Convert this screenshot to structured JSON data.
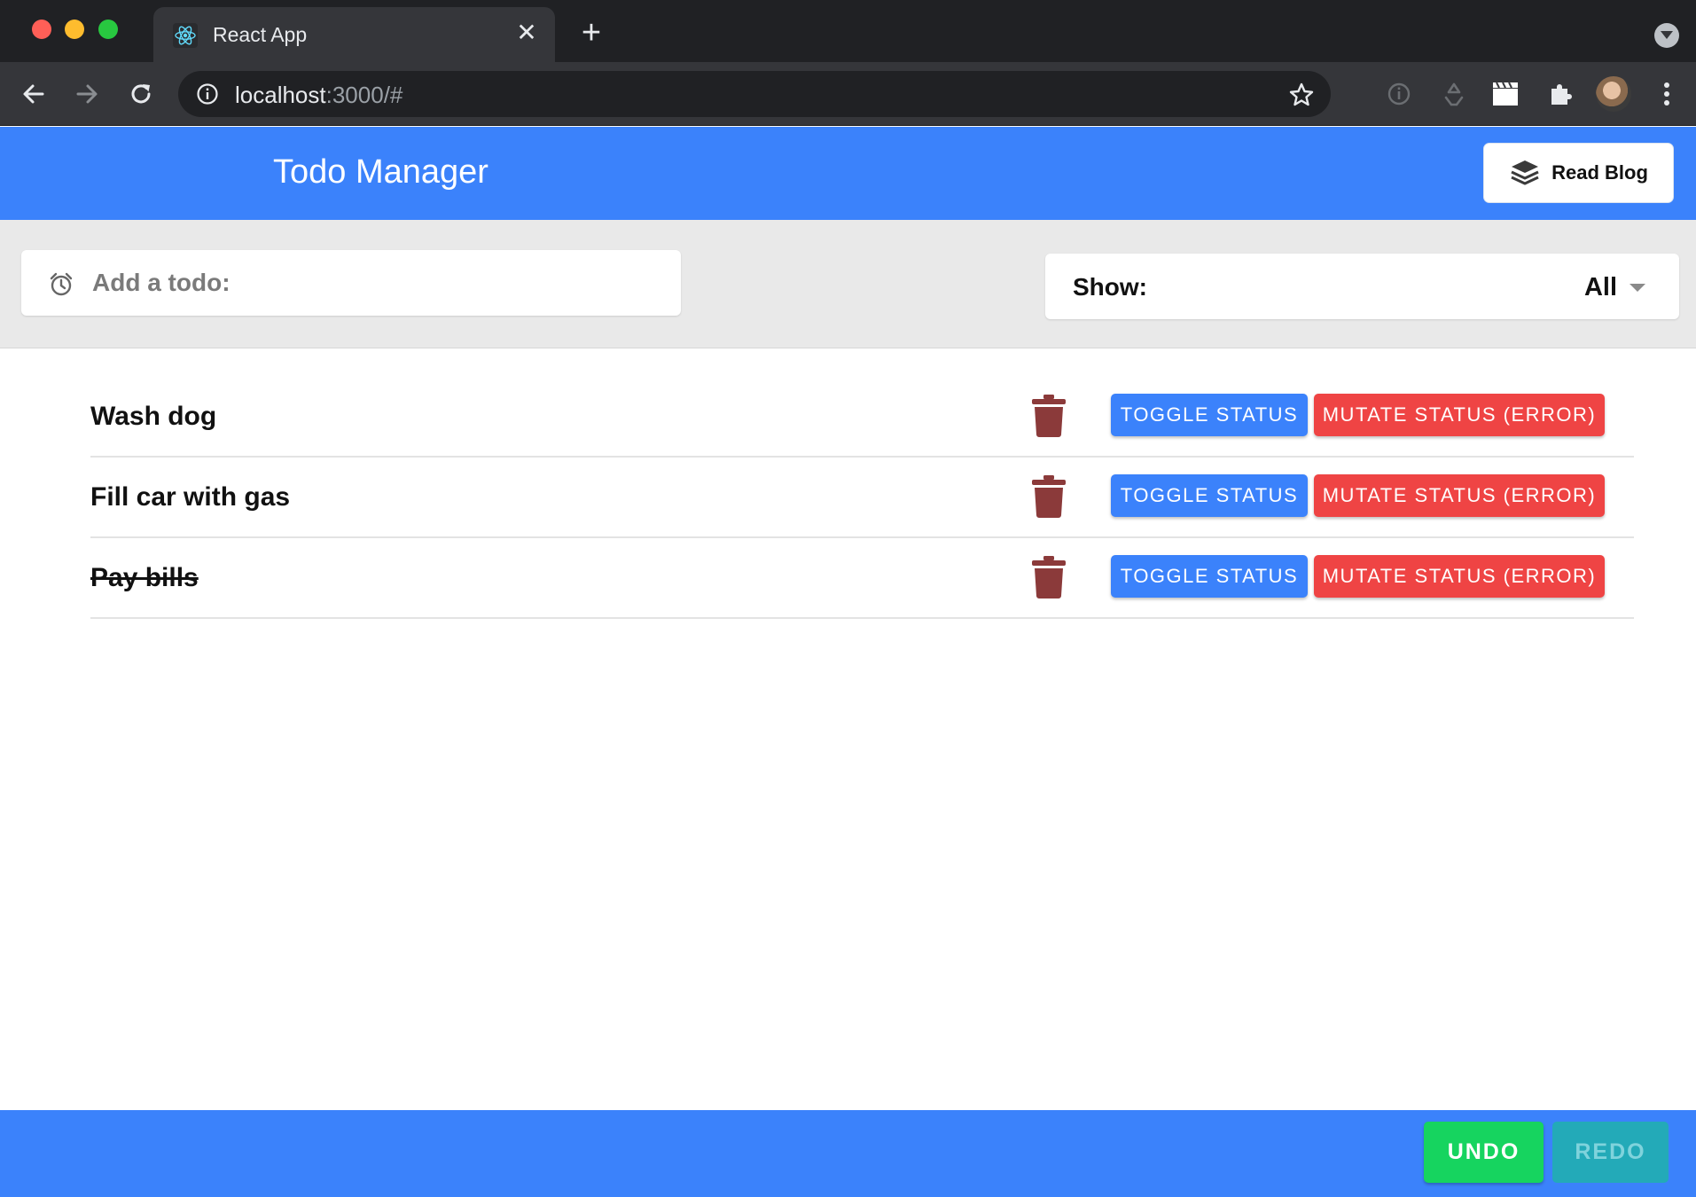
{
  "browser": {
    "tab_title": "React App",
    "tab_close_glyph": "✕",
    "new_tab_glyph": "+",
    "url_host": "localhost",
    "url_rest": ":3000/#"
  },
  "header": {
    "title": "Todo Manager",
    "blog_button_label": "Read Blog",
    "accent_color": "#3b82fb"
  },
  "controls": {
    "add_placeholder": "Add a todo:",
    "show_label": "Show:",
    "show_selected": "All"
  },
  "todos": [
    {
      "text": "Wash dog",
      "completed": false,
      "toggle_label": "TOGGLE STATUS",
      "mutate_label": "MUTATE STATUS (ERROR)"
    },
    {
      "text": "Fill car with gas",
      "completed": false,
      "toggle_label": "TOGGLE STATUS",
      "mutate_label": "MUTATE STATUS (ERROR)"
    },
    {
      "text": "Pay bills",
      "completed": true,
      "toggle_label": "TOGGLE STATUS",
      "mutate_label": "MUTATE STATUS (ERROR)"
    }
  ],
  "footer": {
    "undo_label": "UNDO",
    "redo_label": "REDO"
  },
  "colors": {
    "toggle": "#3b82fb",
    "mutate": "#ef4444",
    "trash": "#8b3a3a",
    "undo": "#16d45f",
    "redo": "#23aab8"
  },
  "icons": [
    "react-favicon-icon",
    "back-arrow-icon",
    "forward-arrow-icon",
    "reload-icon",
    "info-icon",
    "star-icon",
    "extension-icon",
    "puzzle-icon",
    "kebab-menu-icon",
    "layers-icon",
    "alarm-clock-icon",
    "trash-icon",
    "dropdown-caret-icon"
  ]
}
